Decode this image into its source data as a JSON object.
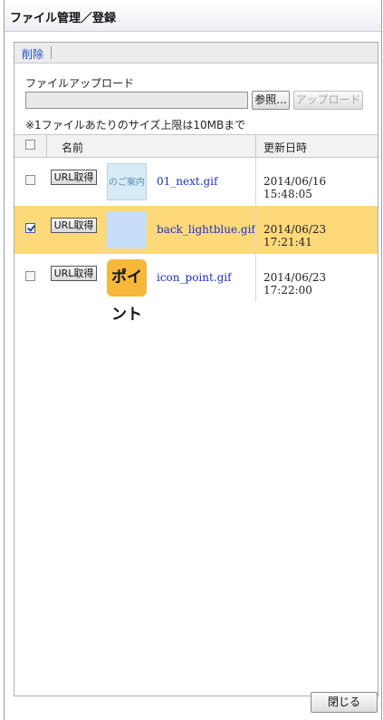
{
  "window": {
    "title": "ファイル管理／登録"
  },
  "toolbar": {
    "delete_label": "削除"
  },
  "upload": {
    "label": "ファイルアップロード",
    "browse_label": "参照...",
    "upload_label": "アップロード",
    "note": "※1ファイルあたりのサイズ上限は10MBまで"
  },
  "table": {
    "headers": {
      "name": "名前",
      "date": "更新日時"
    },
    "rows": [
      {
        "checked": false,
        "url_button": "URL取得",
        "thumb_text": "のご案内",
        "filename": "01_next.gif",
        "date": "2014/06/16 15:48:05"
      },
      {
        "checked": true,
        "url_button": "URL取得",
        "thumb_text": "",
        "filename": "back_lightblue.gif",
        "date": "2014/06/23 17:21:41"
      },
      {
        "checked": false,
        "url_button": "URL取得",
        "thumb_text": "ポイント",
        "filename": "icon_point.gif",
        "date": "2014/06/23 17:22:00"
      }
    ]
  },
  "footer": {
    "close_label": "閉じる"
  },
  "colors": {
    "selected_row": "#fdd97a",
    "link": "#1c2fc0",
    "accent_thumb": "#f6b73a"
  }
}
